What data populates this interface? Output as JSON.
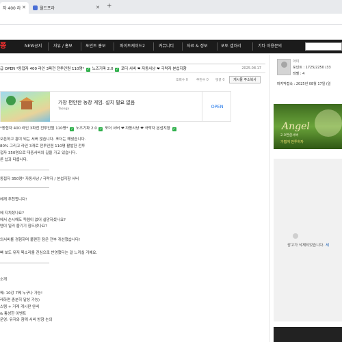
{
  "browser": {
    "tabs": [
      {
        "label": "자 400 라",
        "active": true
      },
      {
        "label": "월드프라",
        "active": false
      }
    ],
    "new_tab": "+"
  },
  "site": {
    "brand": "쫑",
    "nav": [
      "NEW공지",
      "자유 / 홍보",
      "포인트 홍보",
      "파이트케이드2",
      "커뮤니티",
      "자료 & 정보",
      "포토 갤러리",
      "기타 이용문의"
    ]
  },
  "article": {
    "title": "급 OPEN *동접자 400 라인 3파전 전투인원 110명*",
    "title_tags": [
      "노즈기파 2.0",
      "포더 서버 ❤ 자동사냥 ❤ 극락자 본섭지향"
    ],
    "date": "2025.08.17",
    "meta": {
      "views": "조회수 0",
      "likes": "추천수 0",
      "comments": "댓글 0"
    },
    "shorturl_button": "게시물 주소복사"
  },
  "ad": {
    "headline": "가장 편안한 농장 게임. 설치 필요 없음",
    "sub": "Taonga",
    "open": "OPEN"
  },
  "body": {
    "line_tags": "*동접자 400 라인 3파전 전투인원 110명*",
    "line_tags_b": "노즈기파 2.0",
    "line_tags_c": "포더 서버 ❤ 자동사냥 ❤ 극락자 본섭지향",
    "lines_a": [
      "오픈하고 흥미 되는 서버 많습니다. 포더는 해냈습니다.",
      "80% 그리고 라인 3개로 전투인원 110명 활발한 전투",
      "접자 350명으로 대중서버의 길을 가고 있습니다.",
      "른 섭과 다릅니다."
    ],
    "server_line": "동접자 350명* 자동사냥 / 극락자 / 본섭지향 서버",
    "lines_b": [
      "에게 추천합니다!",
      "",
      "에 지치셨나요?",
      "에서 순시해도 득템이 없어 실망하셨나요?",
      "템이 일러 즐기기 힘드셨나요?",
      "",
      "의서버를 경험하며 불편한 점은 전부 개선했습니다!",
      "",
      "빠 보도 유저 목소리를 진심으로 반영했다는 걸 느끼실 거예요."
    ],
    "section_title": "소개",
    "lines_c": [
      "퀘: 10강 7퀘 누구나 가능!",
      "레하면 충분히 달성 가능)",
      "스템 + 거래 게시판 완비",
      "& 통성한 이벤트",
      "운영: 유저와 함께 서버 방향 논의"
    ]
  },
  "sidebar": {
    "profile_name": "아이",
    "points": "포인트 : 1725/2250 (33",
    "level": "레벨 : 4",
    "last_login": "마지막접속 : 2025년 08월 17일 (일",
    "banner_brand": "Angel",
    "banner_line1": "2.0연결서버",
    "banner_line2": "가볍게 전투하자",
    "adslot_text": "광고가 삭제되었습니다.",
    "adslot_link": "세"
  },
  "colors": {
    "nav_bg": "#1b1b1b",
    "brand_red": "#ff3030",
    "check_green": "#30b04c",
    "open_blue": "#1a73e8"
  }
}
